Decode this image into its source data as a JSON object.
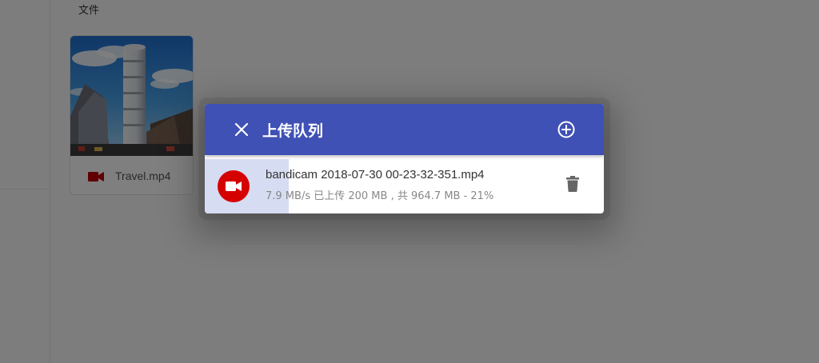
{
  "page": {
    "section_label": "文件"
  },
  "files": [
    {
      "name": "Travel.mp4",
      "icon": "video-camera-icon"
    }
  ],
  "dialog": {
    "title": "上传队列",
    "close_icon": "close-icon",
    "add_icon": "add-circle-icon",
    "uploads": [
      {
        "filename": "bandicam 2018-07-30 00-23-32-351.mp4",
        "status": "7.9 MB/s 已上传 200 MB , 共 964.7 MB - 21%",
        "progress_percent": 21,
        "icon": "video-camera-icon",
        "delete_icon": "trash-icon"
      }
    ]
  },
  "colors": {
    "header": "#3f51b5",
    "video_icon": "#d50000",
    "progress": "#d6dcf2"
  }
}
